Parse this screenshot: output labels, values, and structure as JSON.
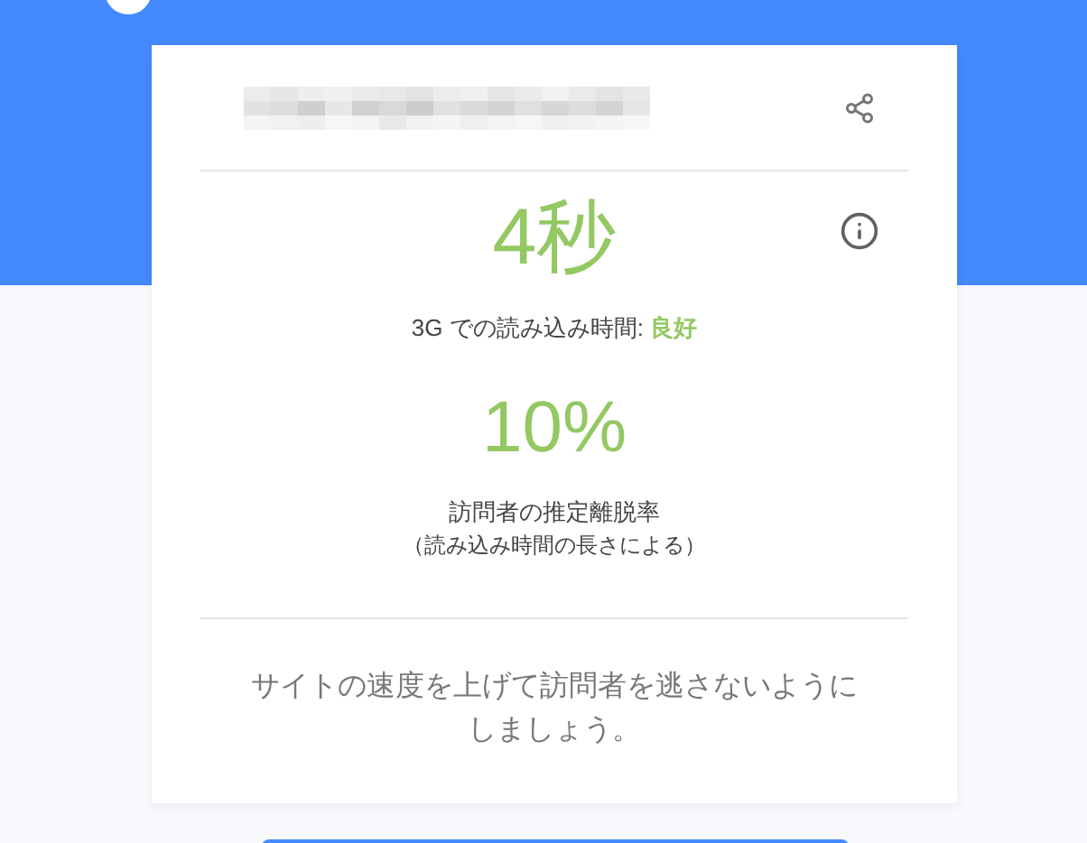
{
  "load_time": {
    "value": "4秒",
    "label": "3G での読み込み時間: **良好**"
  },
  "bounce": {
    "value": "10%",
    "label": "訪問者の推定離脱率",
    "note": "（読み込み時間の長さによる）"
  },
  "message": "サイトの速度を上げて訪問者を逃さないようにしましょう。"
}
